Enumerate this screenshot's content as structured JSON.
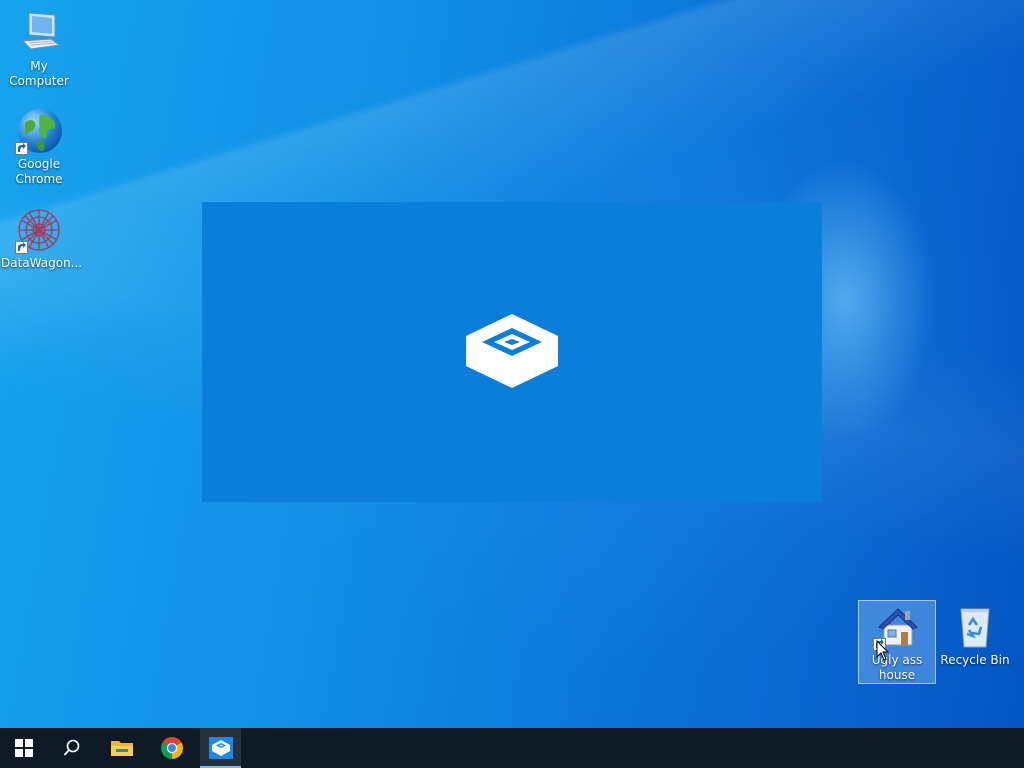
{
  "desktop": {
    "icons": [
      {
        "label": "My Computer",
        "icon": "computer-icon"
      },
      {
        "label": "Google Chrome",
        "icon": "chrome-globe-icon"
      },
      {
        "label": "DataWagon...",
        "icon": "datawagon-icon"
      },
      {
        "label": "Ugly ass house",
        "icon": "house-icon"
      },
      {
        "label": "Recycle Bin",
        "icon": "recycle-bin-icon"
      }
    ]
  },
  "splash": {
    "logo": "sandbox-box-icon",
    "color": "#0a7ed8"
  },
  "taskbar": {
    "items": [
      {
        "name": "Start",
        "icon": "windows-logo-icon"
      },
      {
        "name": "Search",
        "icon": "search-icon"
      },
      {
        "name": "File Explorer",
        "icon": "folder-icon"
      },
      {
        "name": "Google Chrome",
        "icon": "chrome-icon"
      },
      {
        "name": "Sandbox",
        "icon": "sandbox-box-icon",
        "active": true
      }
    ]
  }
}
